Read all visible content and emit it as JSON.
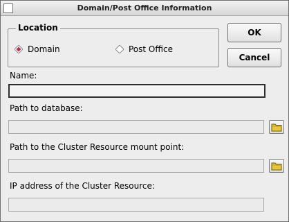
{
  "window": {
    "title": "Domain/Post Office Information"
  },
  "location": {
    "label": "Location",
    "options": [
      {
        "label": "Domain",
        "selected": true
      },
      {
        "label": "Post Office",
        "selected": false
      }
    ]
  },
  "buttons": {
    "ok": "OK",
    "cancel": "Cancel"
  },
  "fields": {
    "name": {
      "label": "Name:",
      "value": ""
    },
    "db_path": {
      "label": "Path to database:",
      "value": ""
    },
    "mount_point": {
      "label": "Path to the Cluster Resource mount point:",
      "value": ""
    },
    "ip_address": {
      "label": "IP address of the Cluster Resource:",
      "value": ""
    }
  },
  "colors": {
    "radio_selected": "#c0304a",
    "folder": "#e8c63a"
  },
  "icons": {
    "close": "close-icon",
    "browse": "folder-icon"
  }
}
